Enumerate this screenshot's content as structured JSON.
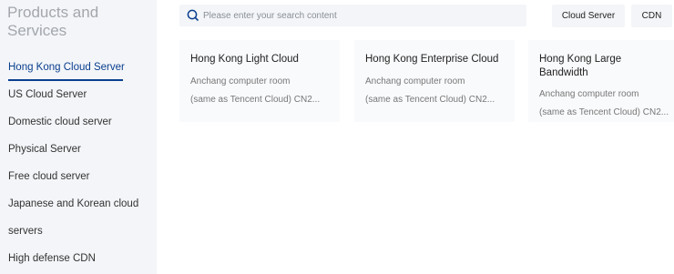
{
  "sidebar": {
    "title": "Products and Services",
    "items": [
      {
        "label": "Hong Kong Cloud Server",
        "active": true
      },
      {
        "label": "US Cloud Server"
      },
      {
        "label": "Domestic cloud server"
      },
      {
        "label": "Physical Server"
      },
      {
        "label": "Free cloud server"
      },
      {
        "label": "Japanese and Korean cloud"
      },
      {
        "label": "servers"
      },
      {
        "label": "High defense CDN"
      }
    ]
  },
  "search": {
    "placeholder": "Please enter your search content",
    "value": ""
  },
  "tags": [
    "Cloud Server",
    "CDN"
  ],
  "cards": [
    {
      "title": "Hong Kong Light Cloud",
      "line1": "Anchang computer room",
      "line2": "(same as Tencent Cloud) CN2..."
    },
    {
      "title": "Hong Kong Enterprise Cloud",
      "line1": "Anchang computer room",
      "line2": "(same as Tencent Cloud) CN2..."
    },
    {
      "title": "Hong Kong Large Bandwidth",
      "line1": "Anchang computer room",
      "line2": "(same as Tencent Cloud) CN2..."
    }
  ],
  "colors": {
    "accent": "#0a3e8f",
    "sidebar_bg": "#f3f5f8",
    "card_bg": "#f9fafc"
  },
  "icons": {
    "search": "search-icon"
  }
}
